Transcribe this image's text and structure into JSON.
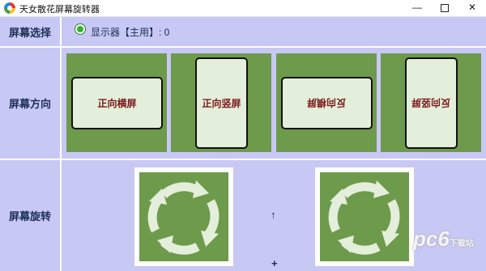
{
  "window": {
    "title": "天女散花屏幕旋转器",
    "minimize": "—",
    "close": "✕"
  },
  "sections": {
    "screen_select": "屏幕选择",
    "orientation": "屏幕方向",
    "rotation": "屏幕旋转"
  },
  "display_option": {
    "label": "显示器【主用】: 0",
    "selected": true
  },
  "orientations": [
    {
      "label": "正向横屏"
    },
    {
      "label": "正向竖屏"
    },
    {
      "label": "反向横屏"
    },
    {
      "label": "反向竖屏"
    }
  ],
  "rotation": {
    "sep_top": "↑",
    "sep_bottom": "+"
  },
  "watermark": {
    "text": "pc6",
    "sub": "下载站"
  },
  "colors": {
    "bg": "#c8c8f4",
    "panel": "#6e9a4b",
    "card": "#e3eedb",
    "text": "#7a1a1a"
  }
}
